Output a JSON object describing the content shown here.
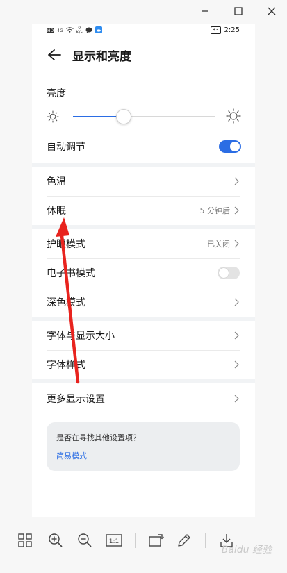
{
  "statusbar": {
    "net": "HD",
    "signal": "4G",
    "speed_value": "0",
    "speed_unit": "K/s",
    "battery": "83",
    "time": "2:25"
  },
  "header": {
    "title": "显示和亮度"
  },
  "brightness": {
    "label": "亮度",
    "level_percent": 36
  },
  "auto_adjust": {
    "label": "自动调节",
    "on": true
  },
  "group1": [
    {
      "label": "色温",
      "value": ""
    },
    {
      "label": "休眠",
      "value": "5 分钟后"
    }
  ],
  "group2": [
    {
      "label": "护眼模式",
      "value": "已关闭"
    },
    {
      "label": "电子书模式",
      "toggle": false
    },
    {
      "label": "深色模式",
      "value": ""
    }
  ],
  "group3": [
    {
      "label": "字体与显示大小"
    },
    {
      "label": "字体样式"
    }
  ],
  "more": {
    "label": "更多显示设置"
  },
  "hint": {
    "question": "是否在寻找其他设置项？",
    "link": "简易模式"
  },
  "watermark": "Baidu 经验",
  "colors": {
    "accent": "#2b6de4",
    "annotation": "#e8231e"
  }
}
